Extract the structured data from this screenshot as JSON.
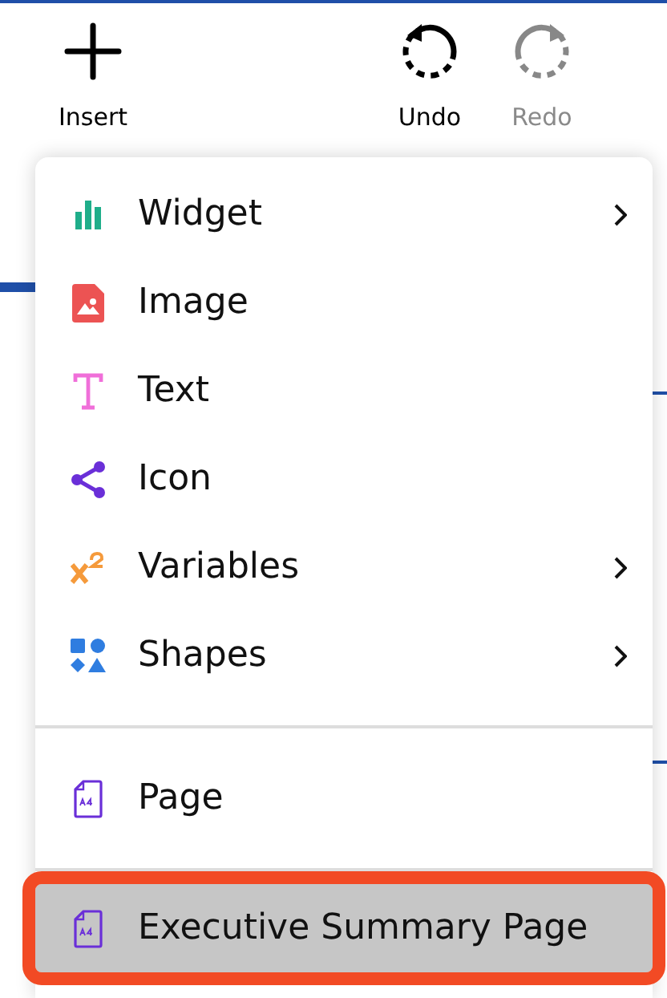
{
  "toolbar": [
    {
      "kind": "insert",
      "label": "Insert",
      "disabled": false
    },
    {
      "kind": "undo",
      "label": "Undo",
      "disabled": false
    },
    {
      "kind": "redo",
      "label": "Redo",
      "disabled": true
    }
  ],
  "menu": {
    "sections": [
      {
        "items": [
          {
            "kind": "widget",
            "label": "Widget",
            "submenu": true,
            "selected": false
          },
          {
            "kind": "image",
            "label": "Image",
            "submenu": false,
            "selected": false
          },
          {
            "kind": "text",
            "label": "Text",
            "submenu": false,
            "selected": false
          },
          {
            "kind": "icon",
            "label": "Icon",
            "submenu": false,
            "selected": false
          },
          {
            "kind": "variables",
            "label": "Variables",
            "submenu": true,
            "selected": false
          },
          {
            "kind": "shapes",
            "label": "Shapes",
            "submenu": true,
            "selected": false
          }
        ]
      },
      {
        "items": [
          {
            "kind": "page",
            "label": "Page",
            "submenu": false,
            "selected": false
          }
        ]
      },
      {
        "items": [
          {
            "kind": "page",
            "label": "Executive Summary Page",
            "submenu": false,
            "selected": true
          }
        ]
      }
    ]
  }
}
